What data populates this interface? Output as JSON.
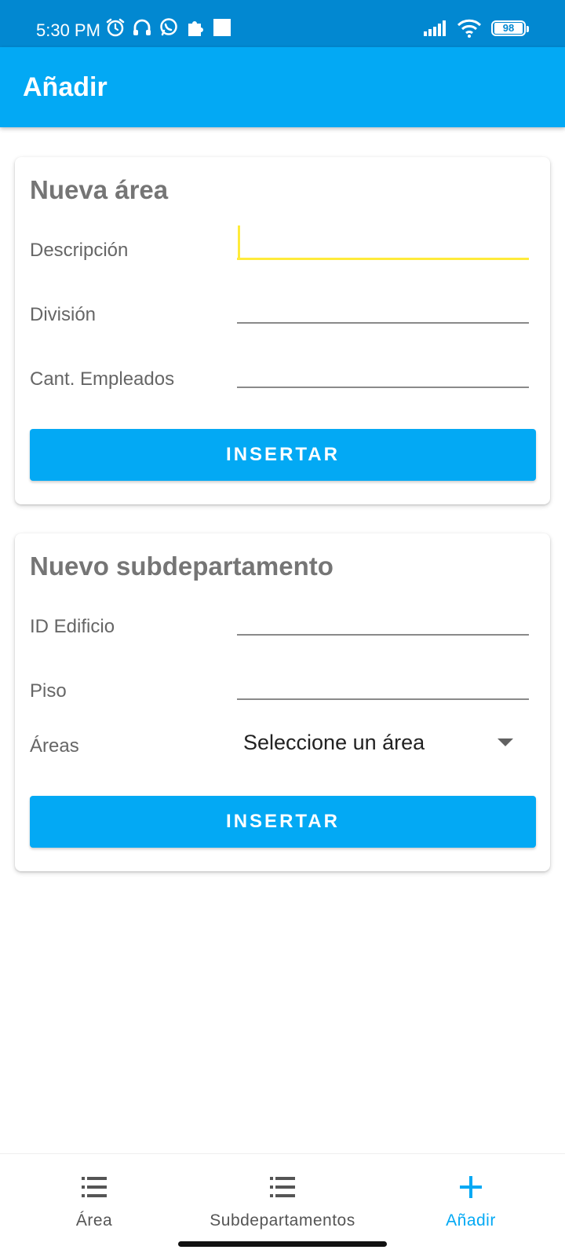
{
  "status_bar": {
    "time": "5:30 PM",
    "battery": "98",
    "icons": [
      "alarm-icon",
      "headset-icon",
      "whatsapp-icon",
      "puzzle-icon",
      "square-icon",
      "signal-icon",
      "wifi-icon",
      "battery-icon"
    ]
  },
  "app_bar": {
    "title": "Añadir"
  },
  "area_form": {
    "title": "Nueva área",
    "description_label": "Descripción",
    "description_value": "",
    "division_label": "División",
    "division_value": "",
    "employees_label": "Cant. Empleados",
    "employees_value": "",
    "submit_label": "INSERTAR"
  },
  "subdepartment_form": {
    "title": "Nuevo subdepartamento",
    "building_label": "ID Edificio",
    "building_value": "",
    "floor_label": "Piso",
    "floor_value": "",
    "areas_label": "Áreas",
    "areas_selected": "Seleccione un área",
    "submit_label": "INSERTAR"
  },
  "bottom_nav": {
    "items": [
      {
        "label": "Área",
        "icon": "list-icon",
        "active": false
      },
      {
        "label": "Subdepartamentos",
        "icon": "list-icon",
        "active": false
      },
      {
        "label": "Añadir",
        "icon": "plus-icon",
        "active": true
      }
    ]
  },
  "colors": {
    "status_bar": "#0288d1",
    "app_bar": "#03a9f4",
    "accent": "#03a9f4",
    "focus_underline": "#ffeb3b"
  }
}
